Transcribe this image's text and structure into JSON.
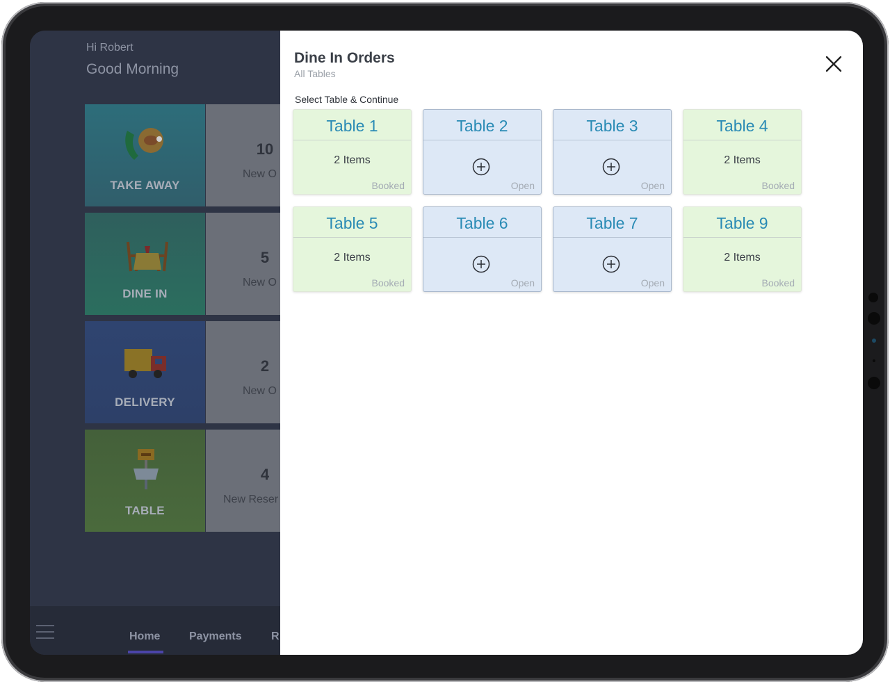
{
  "greeting": {
    "name": "Hi Robert",
    "message": "Good Morning"
  },
  "categories": [
    {
      "label": "TAKE AWAY",
      "count": "10",
      "sub": "New O",
      "icon": "takeaway-icon"
    },
    {
      "label": "DINE IN",
      "count": "5",
      "sub": "New O",
      "icon": "dine-in-icon"
    },
    {
      "label": "DELIVERY",
      "count": "2",
      "sub": "New O",
      "icon": "delivery-truck-icon"
    },
    {
      "label": "TABLE",
      "count": "4",
      "sub": "New Reser",
      "icon": "table-sign-icon"
    }
  ],
  "tabs": [
    {
      "label": "Home",
      "active": true
    },
    {
      "label": "Payments",
      "active": false
    },
    {
      "label": "R",
      "active": false
    }
  ],
  "modal": {
    "title": "Dine In Orders",
    "subtitle": "All Tables",
    "instruction": "Select Table & Continue",
    "tables": [
      {
        "name": "Table 1",
        "items": "2 Items",
        "status": "Booked"
      },
      {
        "name": "Table 2",
        "items": "",
        "status": "Open"
      },
      {
        "name": "Table 3",
        "items": "",
        "status": "Open"
      },
      {
        "name": "Table 4",
        "items": "2 Items",
        "status": "Booked"
      },
      {
        "name": "Table 5",
        "items": "2 Items",
        "status": "Booked"
      },
      {
        "name": "Table 6",
        "items": "",
        "status": "Open"
      },
      {
        "name": "Table 7",
        "items": "",
        "status": "Open"
      },
      {
        "name": "Table 9",
        "items": "2 Items",
        "status": "Booked"
      }
    ]
  },
  "colors": {
    "accent": "#2a8bb5",
    "booked_bg": "#e5f6dc",
    "open_bg": "#dde8f6",
    "tab_indicator": "#4b44a8"
  }
}
